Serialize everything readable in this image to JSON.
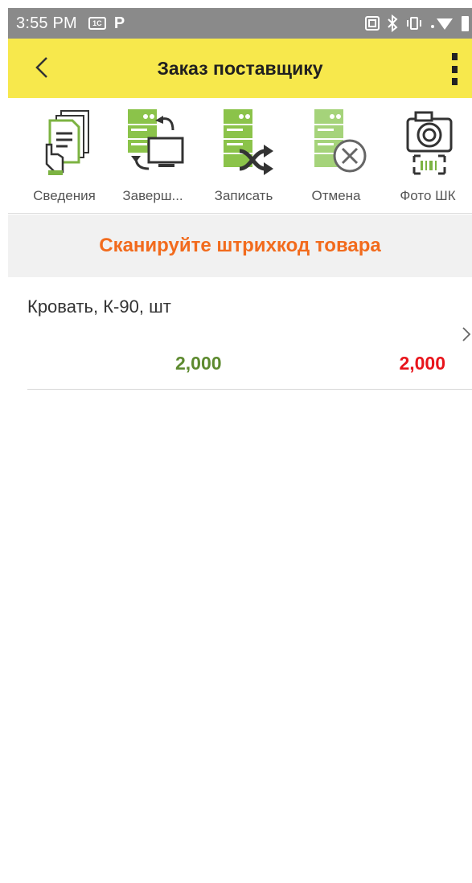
{
  "status_bar": {
    "time": "3:55 PM",
    "icons": [
      "1c-icon",
      "parking-p-icon",
      "nfc-icon",
      "bluetooth-icon",
      "vibrate-icon",
      "wifi-icon",
      "battery-icon"
    ],
    "icon_1c_text": "1С",
    "icon_p_text": "P"
  },
  "app_bar": {
    "title": "Заказ поставщику",
    "accent_color": "#f7e84c"
  },
  "toolbar": {
    "items": [
      {
        "label": "Сведения",
        "icon": "document-hand-icon"
      },
      {
        "label": "Заверш...",
        "icon": "server-sync-monitor-icon"
      },
      {
        "label": "Записать",
        "icon": "server-shuffle-icon"
      },
      {
        "label": "Отмена",
        "icon": "server-cancel-icon"
      },
      {
        "label": "Фото ШК",
        "icon": "camera-barcode-icon"
      }
    ]
  },
  "scan_banner": {
    "text": "Сканируйте штрихкод товара",
    "color": "#f26b1d"
  },
  "items": [
    {
      "name": "Кровать, К-90, шт",
      "qty_planned": "2,000",
      "qty_actual": "2,000",
      "qty_planned_color": "#5d8a2f",
      "qty_actual_color": "#e8141b"
    }
  ]
}
